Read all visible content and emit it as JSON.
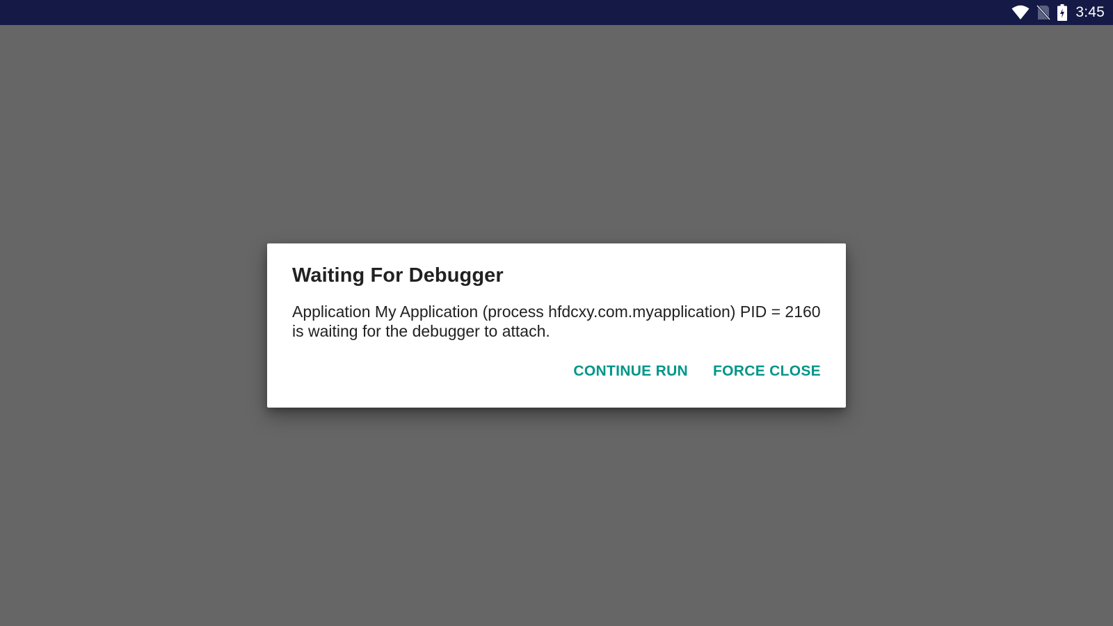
{
  "status_bar": {
    "time": "3:45",
    "icons": [
      "wifi-icon",
      "no-sim-icon",
      "battery-charging-icon"
    ],
    "background": "#141a45"
  },
  "dialog": {
    "title": "Waiting For Debugger",
    "message": "Application My Application (process hfdcxy.com.myapplication) PID = 2160 is waiting for the debugger to attach.",
    "buttons": {
      "continue_run": "CONTINUE RUN",
      "force_close": "FORCE CLOSE"
    },
    "accent_color": "#009688"
  },
  "scrim_color": "#666666"
}
